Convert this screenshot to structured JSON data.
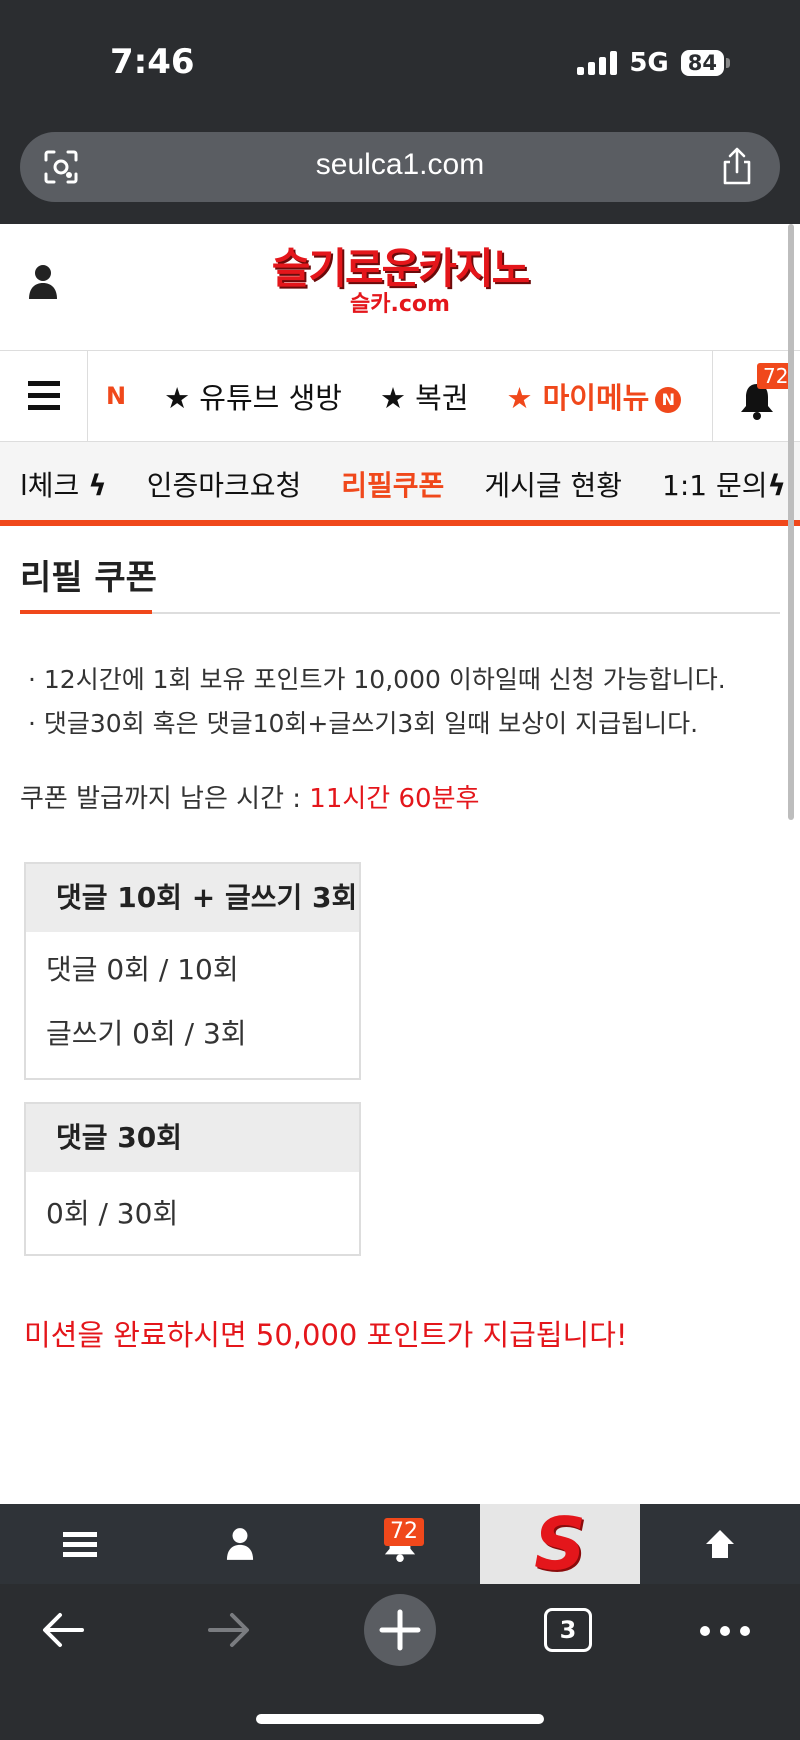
{
  "status": {
    "time": "7:46",
    "network": "5G",
    "battery": "84"
  },
  "browser": {
    "url": "seulca1.com",
    "tab_count": "3"
  },
  "site": {
    "logo_main": "슬기로운카지노",
    "logo_sub": "슬카.com"
  },
  "nav1": {
    "partial_badge": "N",
    "items": [
      "★ 유튜브 생방",
      "★ 복권",
      "★ 마이메뉴"
    ],
    "menu_badge": "N",
    "notifications": "72"
  },
  "nav2": {
    "items": [
      "l체크",
      "인증마크요청",
      "리필쿠폰",
      "게시글 현황",
      "1:1 문의"
    ],
    "active_index": 2
  },
  "page": {
    "title": "리필 쿠폰",
    "notes": [
      "· 12시간에 1회 보유 포인트가 10,000 이하일때 신청 가능합니다.",
      "· 댓글30회 혹은 댓글10회+글쓰기3회 일때 보상이 지급됩니다."
    ],
    "remain_label": "쿠폰 발급까지 남은 시간 :",
    "remain_value": "11시간 60분후",
    "mission_a": {
      "title": "댓글 10회 + 글쓰기 3회",
      "rows": [
        "댓글 0회 / 10회",
        "글쓰기 0회 / 3회"
      ]
    },
    "mission_b": {
      "title": "댓글 30회",
      "rows": [
        "0회 / 30회"
      ]
    },
    "reward_text": "미션을 완료하시면 50,000 포인트가 지급됩니다!"
  },
  "sitebar": {
    "notifications": "72",
    "logo_letter": "S"
  },
  "colors": {
    "accent": "#f0481b",
    "red": "#e4161b",
    "chrome": "#2b2d30"
  }
}
